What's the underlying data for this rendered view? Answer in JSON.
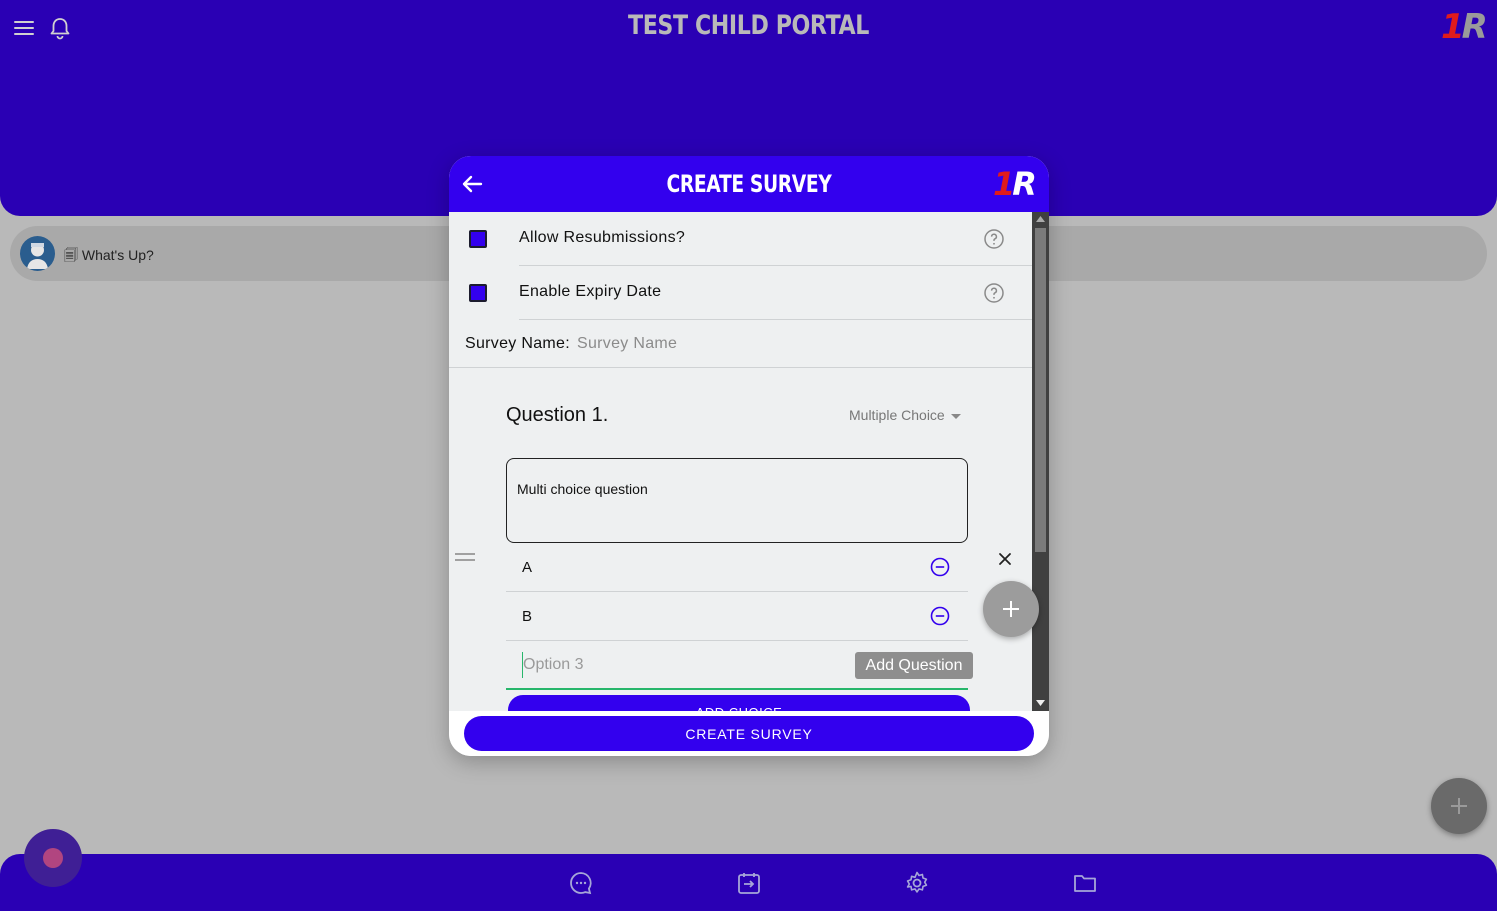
{
  "app": {
    "portal_title": "TEST CHILD PORTAL",
    "logo_number": "1",
    "logo_letter": "R"
  },
  "header": {
    "menu_icon": "hamburger-menu-icon",
    "notification_icon": "bell-icon"
  },
  "status_bar": {
    "text": "🗐 What's Up?",
    "avatar_icon": "nurse-avatar-icon"
  },
  "modal": {
    "title": "CREATE SURVEY",
    "back_icon": "arrow-left-icon",
    "logo_number": "1",
    "logo_letter": "R",
    "options": [
      {
        "label": "Allow Resubmissions?",
        "checked": true,
        "help_icon": "question-circle-icon"
      },
      {
        "label": "Enable Expiry Date",
        "checked": true,
        "help_icon": "question-circle-icon"
      }
    ],
    "survey_name": {
      "label": "Survey Name:",
      "value": "",
      "placeholder": "Survey Name"
    },
    "question": {
      "title": "Question 1.",
      "type": "Multiple Choice",
      "text": "Multi choice question",
      "choices": [
        "A",
        "B"
      ],
      "new_option_placeholder": "Option 3",
      "add_choice_label": "ADD CHOICE",
      "remove_icon": "minus-circle-icon",
      "delete_icon": "close-icon",
      "drag_icon": "drag-handle-icon"
    },
    "add_question_tooltip": "Add Question",
    "add_question_icon": "plus-icon",
    "submit_label": "CREATE SURVEY"
  },
  "bottom_nav": {
    "items": [
      "chat-icon",
      "calendar-import-icon",
      "settings-icon",
      "folder-icon"
    ]
  },
  "colors": {
    "brand": "#2a00b4",
    "accent": "#3300ee",
    "logo_red": "#e11b1b"
  }
}
